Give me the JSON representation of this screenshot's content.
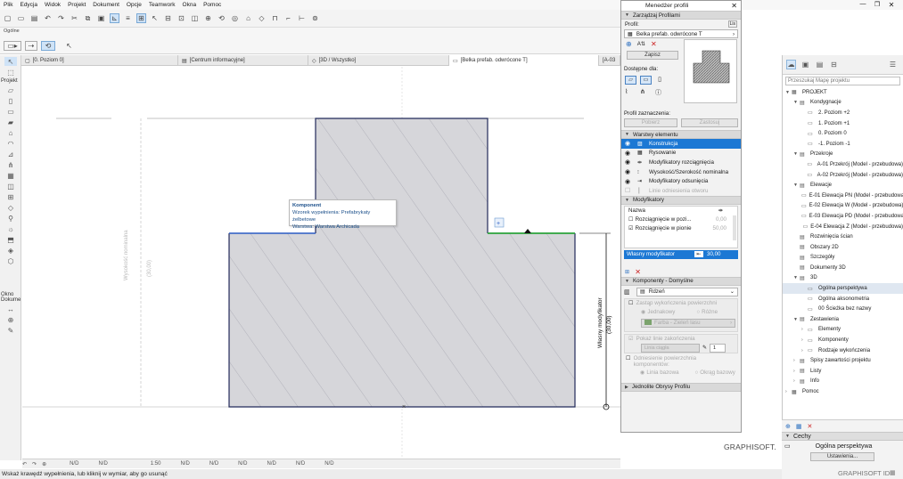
{
  "menu": [
    "Plik",
    "Edycja",
    "Widok",
    "Projekt",
    "Dokument",
    "Opcje",
    "Teamwork",
    "Okna",
    "Pomoc"
  ],
  "infobox": {
    "label": "Ogólne"
  },
  "tabs": [
    "[0. Poziom 0]",
    "[Centrum informacyjne]",
    "[3D / Wszystko]",
    "[Belka prefab. odwrócone T]",
    "[A-03"
  ],
  "toolbox": {
    "arrow_label": "Projekt",
    "okno_label": "Okno",
    "dokument_label": "Dokume"
  },
  "drawing": {
    "tooltip_title": "Komponent",
    "tooltip_line1": "Wzorek wypełnienia: Prefabrykaty żelbetowe",
    "tooltip_line2": "Warstwa: Warstwa Archicada",
    "dim_left": "Wysokość nominalna",
    "dim_left_val": "(30,00)",
    "dim_right": "Własny modyfikator",
    "dim_right_val": "(30,00)"
  },
  "status": {
    "n1": "N/D",
    "n2": "N/D",
    "scale": "1:50",
    "n3": "N/D",
    "n4": "N/D",
    "n5": "N/D",
    "n6": "N/D",
    "n7": "N/D",
    "n8": "N/D"
  },
  "hint": "Wskaż krawędź wypełnienia, lub kliknij w wymiar, aby go usunąć",
  "profile_manager": {
    "title": "Menedżer profili",
    "manage_section": "Zarządzaj Profilami",
    "profile_label": "Profil:",
    "profile_value": "Belka prefab. odwrócone T",
    "save_btn": "Zapisz",
    "available_label": "Dostępne dla:",
    "selection_label": "Profil zaznaczenia:",
    "get_btn": "Pobierz",
    "apply_btn": "Zastosuj",
    "layers_section": "Warstwy elementu",
    "layers": [
      "Konstrukcja",
      "Rysowanie",
      "Modyfikatory rozciągnięcia",
      "Wysokość/Szerokość nominalna",
      "Modyfikatory odsunięcia",
      "Linie odniesienia otworu"
    ],
    "modifiers_section": "Modyfikatory",
    "col_name": "Nazwa",
    "stretch_h": "Rozciągnięcie w pozi...",
    "stretch_h_val": "0,00",
    "stretch_v": "Rozciągnięcie w pionie",
    "stretch_v_val": "50,00",
    "custom_mod": "Własny modyfikator",
    "custom_mod_val": "30,00",
    "components_section": "Komponenty - Domyślne",
    "core_value": "Rdzeń",
    "override_surface": "Zastąp wykończenia powierzchni",
    "uniform": "Jednakowy",
    "different": "Różne",
    "paint_value": "Farba - Zieleń lasu",
    "show_end_lines": "Pokaż linie zakończenia",
    "line_type": "Linia ciągła",
    "pen_value": "1",
    "ref_surface": "Odniesienie powierzchnia komponentów:",
    "base_line": "Linia bazowa",
    "bounding_box": "Okrąg bazowy",
    "unify_section": "Jednolite Obrysy Profilu"
  },
  "graphisoft": "GRAPHISOFT.",
  "navigator": {
    "search_placeholder": "Przeszukaj Mapę projektu",
    "tree": [
      {
        "label": "PROJEKT",
        "level": 0,
        "arrow": "▼"
      },
      {
        "label": "Kondygnacje",
        "level": 1,
        "arrow": "▼"
      },
      {
        "label": "2. Poziom +2",
        "level": 2,
        "arrow": ""
      },
      {
        "label": "1. Poziom +1",
        "level": 2,
        "arrow": ""
      },
      {
        "label": "0. Poziom 0",
        "level": 2,
        "arrow": ""
      },
      {
        "label": "-1. Poziom -1",
        "level": 2,
        "arrow": ""
      },
      {
        "label": "Przekroje",
        "level": 1,
        "arrow": "▼"
      },
      {
        "label": "A-01 Przekrój (Model - przebudowa)",
        "level": 2,
        "arrow": ""
      },
      {
        "label": "A-02 Przekrój (Model - przebudowa)",
        "level": 2,
        "arrow": ""
      },
      {
        "label": "Elewacje",
        "level": 1,
        "arrow": "▼"
      },
      {
        "label": "E-01 Elewacja PN (Model - przebudowa)",
        "level": 2,
        "arrow": ""
      },
      {
        "label": "E-02 Elewacja W (Model - przebudowa)",
        "level": 2,
        "arrow": ""
      },
      {
        "label": "E-03 Elewacja PD (Model - przebudowa)",
        "level": 2,
        "arrow": ""
      },
      {
        "label": "E-04 Elewacja Z (Model - przebudowa)",
        "level": 2,
        "arrow": ""
      },
      {
        "label": "Rozwinięcia ścian",
        "level": 1,
        "arrow": ""
      },
      {
        "label": "Obszary 2D",
        "level": 1,
        "arrow": ""
      },
      {
        "label": "Szczegóły",
        "level": 1,
        "arrow": ""
      },
      {
        "label": "Dokumenty 3D",
        "level": 1,
        "arrow": ""
      },
      {
        "label": "3D",
        "level": 1,
        "arrow": "▼"
      },
      {
        "label": "Ogólna perspektywa",
        "level": 2,
        "arrow": ""
      },
      {
        "label": "Ogólna aksonometria",
        "level": 2,
        "arrow": ""
      },
      {
        "label": "00 Ścieżka bez nazwy",
        "level": 2,
        "arrow": ""
      },
      {
        "label": "Zestawienia",
        "level": 1,
        "arrow": "▼"
      },
      {
        "label": "Elementy",
        "level": 2,
        "arrow": "›"
      },
      {
        "label": "Komponenty",
        "level": 2,
        "arrow": "›"
      },
      {
        "label": "Rodzaje wykończenia",
        "level": 2,
        "arrow": "›"
      },
      {
        "label": "Spisy zawartości projektu",
        "level": 1,
        "arrow": "›"
      },
      {
        "label": "Listy",
        "level": 1,
        "arrow": "›"
      },
      {
        "label": "Info",
        "level": 1,
        "arrow": "›"
      },
      {
        "label": "Pomoc",
        "level": 0,
        "arrow": "›"
      }
    ],
    "selected_index": 19,
    "props_section": "Cechy",
    "props_value": "Ogólna perspektywa",
    "settings_btn": "Ustawienia...",
    "graphisoft_id": "GRAPHISOFT ID"
  }
}
